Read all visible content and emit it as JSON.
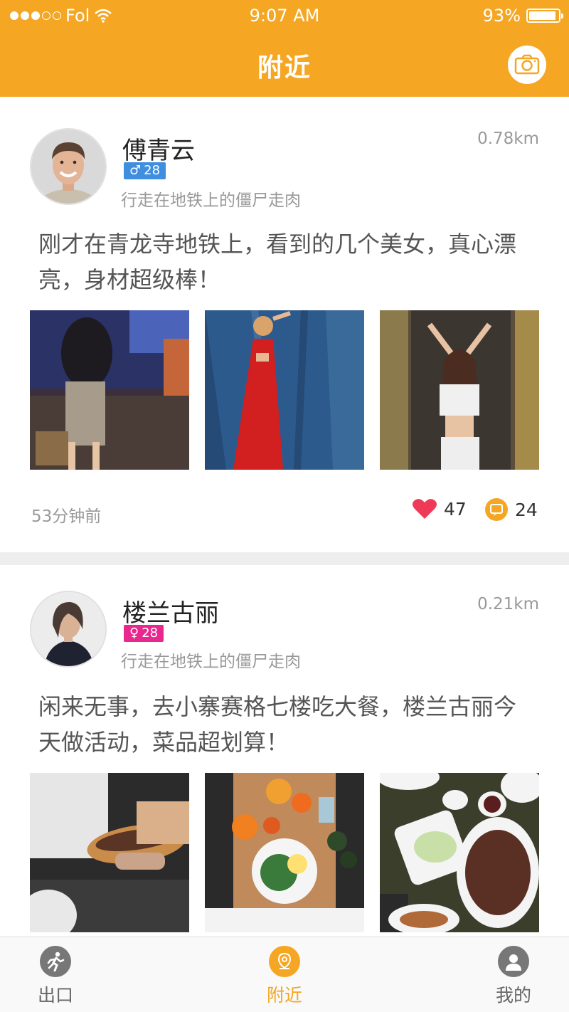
{
  "status_bar": {
    "carrier": "Fol",
    "time": "9:07 AM",
    "battery": "93%",
    "battery_level": 0.93
  },
  "header": {
    "title": "附近",
    "camera_icon": "camera-icon"
  },
  "posts": [
    {
      "user_name": "傅青云",
      "gender": "male",
      "gender_symbol": "♂",
      "age": "28",
      "bio": "行走在地铁上的僵尸走肉",
      "distance": "0.78km",
      "text": "刚才在青龙寺地铁上，看到的几个美女，真心漂亮，身材超级棒！",
      "time": "53分钟前",
      "likes": "47",
      "comments": "24"
    },
    {
      "user_name": "楼兰古丽",
      "gender": "female",
      "gender_symbol": "♀",
      "age": "28",
      "bio": "行走在地铁上的僵尸走肉",
      "distance": "0.21km",
      "text": "闲来无事，去小寨赛格七楼吃大餐，楼兰古丽今天做活动，菜品超划算！"
    }
  ],
  "tab_bar": {
    "items": [
      {
        "label": "出口",
        "icon": "running-icon"
      },
      {
        "label": "附近",
        "icon": "location-icon"
      },
      {
        "label": "我的",
        "icon": "user-icon"
      }
    ]
  },
  "colors": {
    "accent": "#f5a623",
    "male": "#3f8ee0",
    "female": "#e8278f",
    "like": "#ee3a57"
  }
}
